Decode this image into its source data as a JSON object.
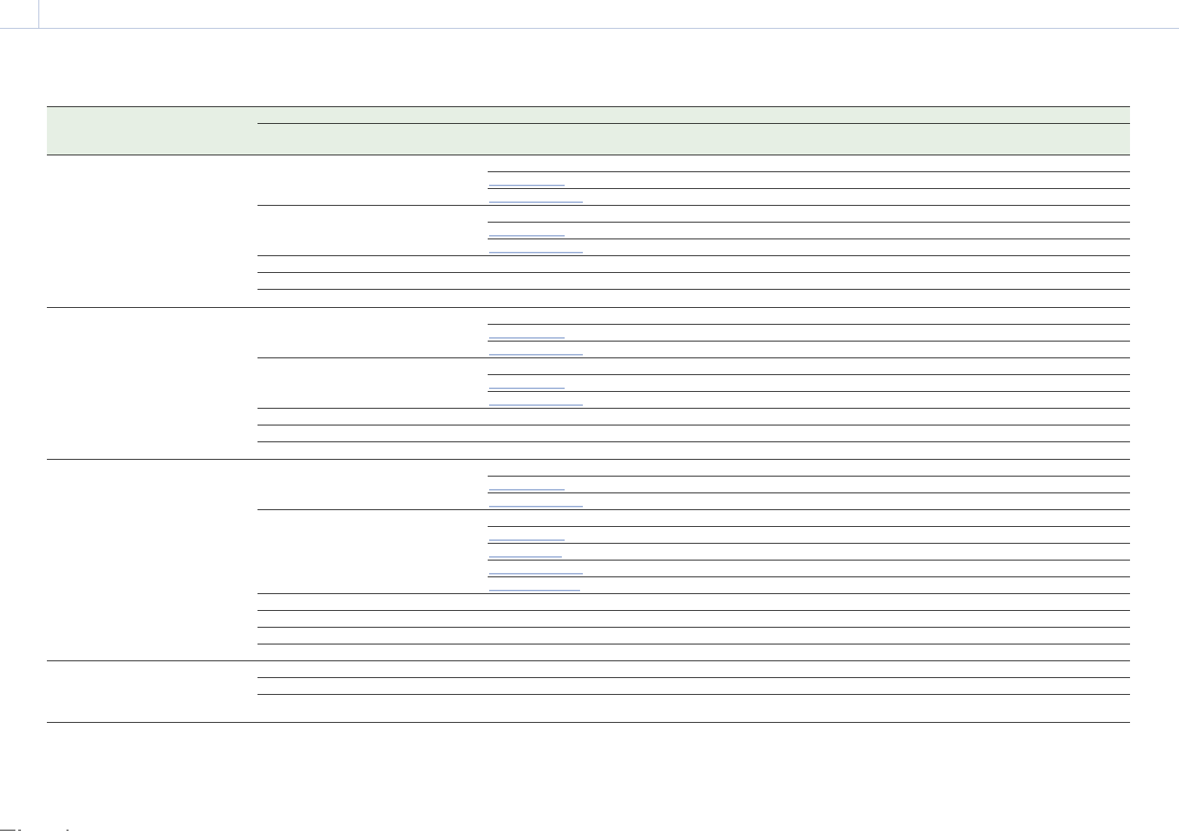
{
  "header": {
    "col_group": "",
    "col_sub": "",
    "col_item": ""
  },
  "groups": [
    {
      "label": "",
      "subgroups": [
        {
          "label": "",
          "items": [
            {
              "text": "",
              "link": false
            },
            {
              "text": "",
              "link": true
            },
            {
              "text": "",
              "link": true
            }
          ]
        },
        {
          "label": "",
          "items": [
            {
              "text": "",
              "link": false
            },
            {
              "text": "",
              "link": true
            },
            {
              "text": "",
              "link": true
            }
          ]
        },
        {
          "label": "",
          "items": []
        },
        {
          "label": "",
          "items": []
        },
        {
          "label": "",
          "items": []
        }
      ]
    },
    {
      "label": "",
      "subgroups": [
        {
          "label": "",
          "items": [
            {
              "text": "",
              "link": false
            },
            {
              "text": "",
              "link": true
            },
            {
              "text": "",
              "link": true
            }
          ]
        },
        {
          "label": "",
          "items": [
            {
              "text": "",
              "link": false
            },
            {
              "text": "",
              "link": true
            },
            {
              "text": "",
              "link": true
            }
          ]
        },
        {
          "label": "",
          "items": []
        },
        {
          "label": "",
          "items": []
        },
        {
          "label": "",
          "items": []
        }
      ]
    },
    {
      "label": "",
      "subgroups": [
        {
          "label": "",
          "items": [
            {
              "text": "",
              "link": false
            },
            {
              "text": "",
              "link": true
            },
            {
              "text": "",
              "link": true
            }
          ]
        },
        {
          "label": "",
          "items": [
            {
              "text": "",
              "link": false
            },
            {
              "text": "",
              "link": true
            },
            {
              "text": "",
              "link": true
            },
            {
              "text": "",
              "link": true
            },
            {
              "text": "",
              "link": true
            }
          ]
        },
        {
          "label": "",
          "items": []
        },
        {
          "label": "",
          "items": []
        },
        {
          "label": "",
          "items": []
        },
        {
          "label": "",
          "items": []
        }
      ]
    },
    {
      "label": "",
      "subgroups": [
        {
          "label": "",
          "items": []
        },
        {
          "label": "",
          "items": []
        },
        {
          "label": "",
          "items": []
        }
      ]
    }
  ],
  "colors": {
    "header_bg": "#e6efe4",
    "rule": "#000000",
    "link": "#9fb3d9",
    "page_rule": "#a9b8d6"
  }
}
